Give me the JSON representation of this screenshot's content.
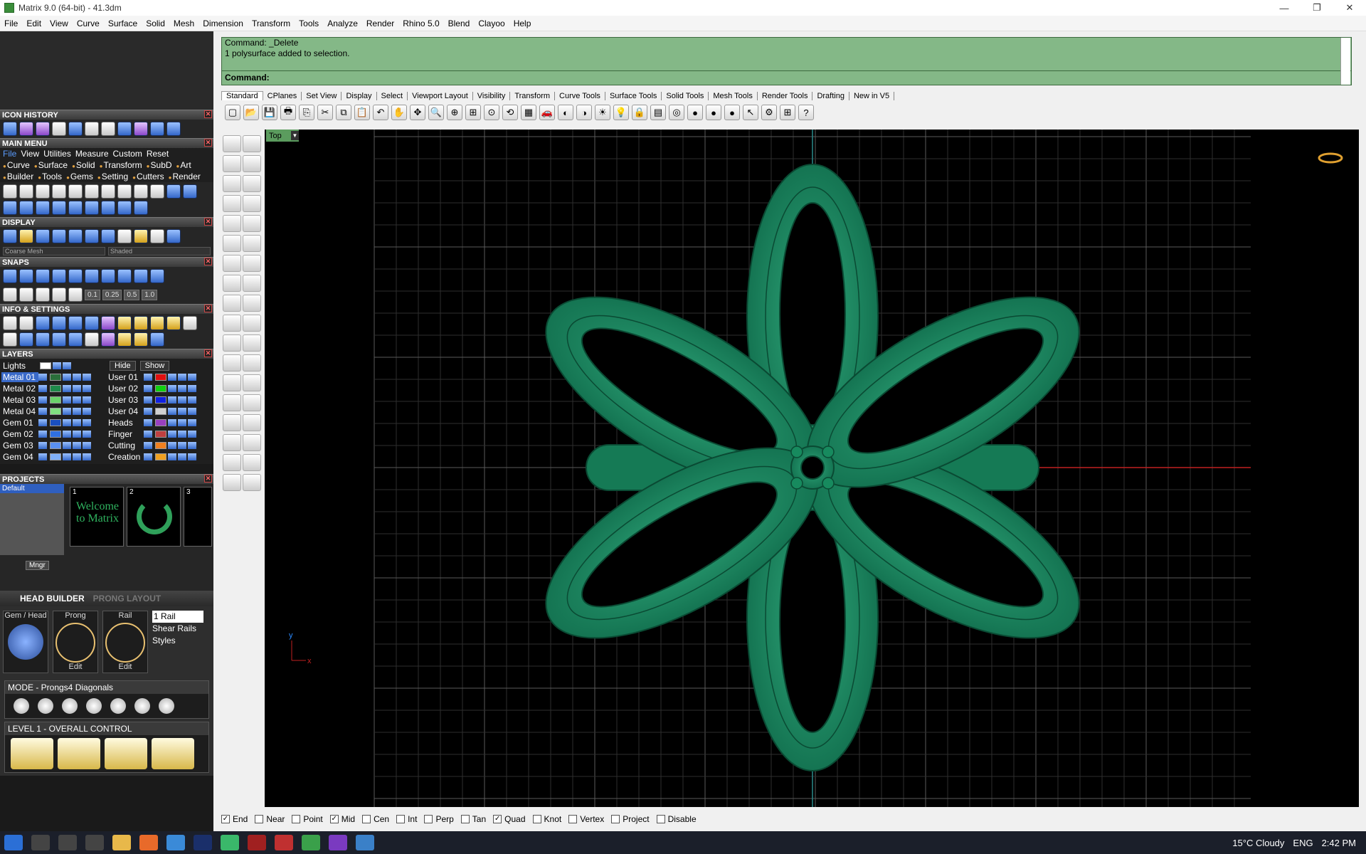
{
  "window": {
    "title": "Matrix 9.0 (64-bit) - 41.3dm",
    "minimize": "—",
    "maximize": "❐",
    "close": "✕"
  },
  "menubar": [
    "File",
    "Edit",
    "View",
    "Curve",
    "Surface",
    "Solid",
    "Mesh",
    "Dimension",
    "Transform",
    "Tools",
    "Analyze",
    "Render",
    "Rhino 5.0",
    "Blend",
    "Clayoo",
    "Help"
  ],
  "leftpanel": {
    "icon_history": "ICON HISTORY",
    "main_menu": "MAIN MENU",
    "menu_tabs": [
      "File",
      "View",
      "Utilities",
      "Measure",
      "Custom",
      "Reset"
    ],
    "menu_items": [
      "Curve",
      "Surface",
      "Solid",
      "Transform",
      "SubD",
      "Art",
      "Builder",
      "Tools",
      "Gems",
      "Setting",
      "Cutters",
      "Render"
    ],
    "display": "DISPLAY",
    "display_mesh": "Coarse Mesh",
    "display_mode": "Shaded",
    "snaps": "SNAPS",
    "snap_values": [
      "0.1",
      "0.25",
      "0.5",
      "1.0"
    ],
    "info": "INFO & SETTINGS",
    "layers": "LAYERS",
    "lights": "Lights",
    "hide": "Hide",
    "show": "Show",
    "layer_rows": [
      {
        "a": "Metal 01",
        "ca": "#2a6e3a",
        "b": "User 01",
        "cb": "#e01010"
      },
      {
        "a": "Metal 02",
        "ca": "#1f8a4a",
        "b": "User 02",
        "cb": "#10d010"
      },
      {
        "a": "Metal 03",
        "ca": "#6ad26a",
        "b": "User 03",
        "cb": "#1020e0"
      },
      {
        "a": "Metal 04",
        "ca": "#80e080",
        "b": "User 04",
        "cb": "#d0d0d0"
      },
      {
        "a": "Gem 01",
        "ca": "#1a4fc0",
        "b": "Heads",
        "cb": "#9a40c0"
      },
      {
        "a": "Gem 02",
        "ca": "#3070e0",
        "b": "Finger",
        "cb": "#c04040"
      },
      {
        "a": "Gem 03",
        "ca": "#5a90f0",
        "b": "Cutting",
        "cb": "#f08020"
      },
      {
        "a": "Gem 04",
        "ca": "#80b0f8",
        "b": "Creation",
        "cb": "#f0a020"
      }
    ],
    "projects": "PROJECTS",
    "project_default": "Default",
    "thumb1": "Welcome to Matrix",
    "mngr": "Mngr",
    "head_builder": "HEAD  BUILDER",
    "prong_layout": "PRONG LAYOUT",
    "gem_head": "Gem / Head",
    "prong": "Prong",
    "rail": "Rail",
    "edit": "Edit",
    "rail_value": "1 Rail",
    "shear": "Shear Rails",
    "styles": "Styles",
    "mode": "MODE - Prongs4 Diagonals",
    "level": "LEVEL 1 - OVERALL CONTROL"
  },
  "command": {
    "line1": "Command: _Delete",
    "line2": "1 polysurface added to selection.",
    "prompt": "Command:"
  },
  "tabs": [
    "Standard",
    "CPlanes",
    "Set View",
    "Display",
    "Select",
    "Viewport Layout",
    "Visibility",
    "Transform",
    "Curve Tools",
    "Surface Tools",
    "Solid Tools",
    "Mesh Tools",
    "Render Tools",
    "Drafting",
    "New in V5"
  ],
  "viewport": {
    "name": "Top",
    "axis_y": "y",
    "axis_x": "x"
  },
  "status": [
    {
      "label": "End",
      "on": true
    },
    {
      "label": "Near",
      "on": false
    },
    {
      "label": "Point",
      "on": false
    },
    {
      "label": "Mid",
      "on": true
    },
    {
      "label": "Cen",
      "on": false
    },
    {
      "label": "Int",
      "on": false
    },
    {
      "label": "Perp",
      "on": false
    },
    {
      "label": "Tan",
      "on": false
    },
    {
      "label": "Quad",
      "on": true
    },
    {
      "label": "Knot",
      "on": false
    },
    {
      "label": "Vertex",
      "on": false
    },
    {
      "label": "Project",
      "on": false
    },
    {
      "label": "Disable",
      "on": false
    }
  ],
  "tray": {
    "weather": "15°C  Cloudy",
    "lang": "ENG",
    "time": "2:42 PM"
  }
}
